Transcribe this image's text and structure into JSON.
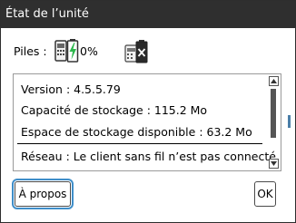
{
  "dialog": {
    "title": "État de l’unité"
  },
  "battery": {
    "label": "Piles :",
    "percent": "0%",
    "level": 0,
    "icon": "battery-charging-icon",
    "secondary_icon": "battery-remove-icon",
    "accent_color": "#2db84d"
  },
  "info": {
    "version": "Version : 4.5.5.79",
    "capacity": "Capacité de stockage : 115.2 Mo",
    "free_space": "Espace de stockage disponible : 63.2 Mo",
    "network": "Réseau : Le client sans fil n’est pas connecté."
  },
  "buttons": {
    "about": "À propos",
    "ok": "OK"
  },
  "colors": {
    "titlebar": "#2f2f2f",
    "focus": "#3f8ec9"
  }
}
